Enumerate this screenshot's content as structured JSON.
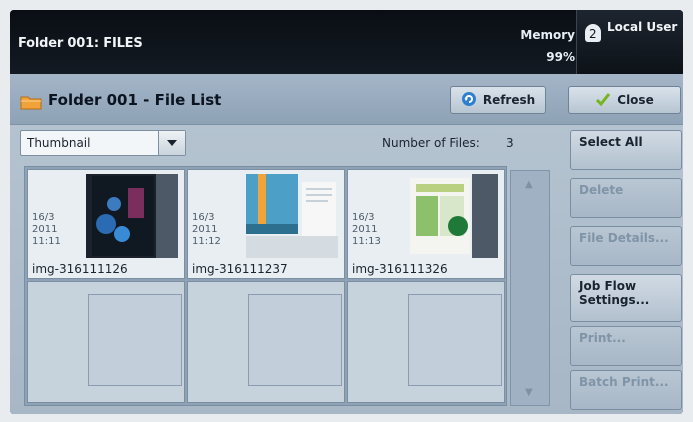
{
  "topbar": {
    "folder_title": "Folder 001: FILES",
    "memory_label": "Memory",
    "memory_value": "99%",
    "user_label": "Local User"
  },
  "header": {
    "list_title": "Folder 001 - File List",
    "refresh_label": "Refresh",
    "close_label": "Close"
  },
  "view": {
    "mode": "Thumbnail",
    "files_label": "Number of Files:",
    "files_count": "3"
  },
  "files": [
    {
      "date": "16/3",
      "year": "2011",
      "time": "11:11",
      "name": "img-316111126"
    },
    {
      "date": "16/3",
      "year": "2011",
      "time": "11:12",
      "name": "img-316111237"
    },
    {
      "date": "16/3",
      "year": "2011",
      "time": "11:13",
      "name": "img-316111326"
    }
  ],
  "actions": {
    "select_all": "Select All",
    "delete": "Delete",
    "file_details": "File Details...",
    "job_flow": "Job Flow Settings...",
    "print": "Print...",
    "batch_print": "Batch Print..."
  },
  "colors": {
    "accent": "#2f7fd0",
    "folder": "#f2a23a",
    "close_check": "#76b51b"
  },
  "icons": [
    "user-icon",
    "folder-icon",
    "refresh-icon",
    "check-icon",
    "chevron-down-icon",
    "scroll-up-icon",
    "scroll-down-icon"
  ]
}
